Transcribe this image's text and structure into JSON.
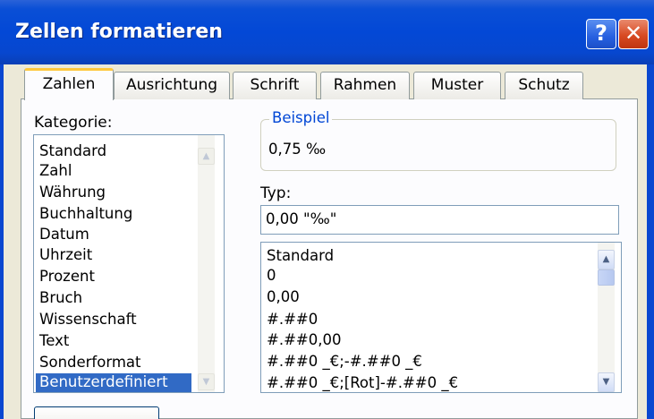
{
  "window": {
    "title": "Zellen formatieren",
    "help_label": "?",
    "close_label": "✕"
  },
  "tabs": [
    {
      "label": "Zahlen",
      "active": true
    },
    {
      "label": "Ausrichtung",
      "active": false
    },
    {
      "label": "Schrift",
      "active": false
    },
    {
      "label": "Rahmen",
      "active": false
    },
    {
      "label": "Muster",
      "active": false
    },
    {
      "label": "Schutz",
      "active": false
    }
  ],
  "category": {
    "label": "Kategorie:",
    "items": [
      "Standard",
      "Zahl",
      "Währung",
      "Buchhaltung",
      "Datum",
      "Uhrzeit",
      "Prozent",
      "Bruch",
      "Wissenschaft",
      "Text",
      "Sonderformat",
      "Benutzerdefiniert"
    ],
    "selected": "Benutzerdefiniert"
  },
  "sample": {
    "legend": "Beispiel",
    "value": "0,75 ‰"
  },
  "type": {
    "label": "Typ:",
    "value": "0,00 \"‰\"",
    "items": [
      "Standard",
      "0",
      "0,00",
      "#.##0",
      "#.##0,00",
      "#.##0 _€;-#.##0 _€",
      "#.##0 _€;[Rot]-#.##0 _€"
    ]
  },
  "icons": {
    "scroll_up": "▲",
    "scroll_down": "▼"
  },
  "colors": {
    "title_bar": "#0348d6",
    "selection": "#316ac5",
    "active_tab_accent": "#ffc83c",
    "dialog_face": "#ece9d8"
  }
}
